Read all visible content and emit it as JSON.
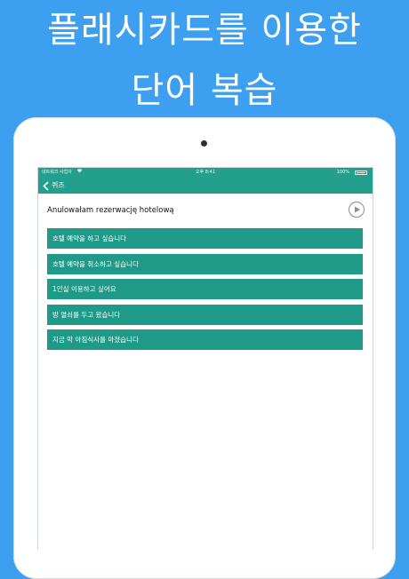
{
  "headline": {
    "line1": "플래시카드를 이용한",
    "line2": "단어 복습"
  },
  "status_bar": {
    "carrier": "네트워크 사업자",
    "time": "오후 8:41",
    "battery": "100%"
  },
  "navbar": {
    "back_label": "퀴즈"
  },
  "question": {
    "text": "Anulowałam rezerwację hotelową"
  },
  "answers": [
    "호텔 예약을 하고 싶습니다",
    "호텔 예약을 취소하고 싶습니다",
    "1인실 이용하고 싶어요",
    "방 열쇠를 두고 왔습니다",
    "지금 막 아침식사를 마쳤습니다"
  ],
  "colors": {
    "background": "#3d9ff0",
    "accent": "#23a08d",
    "answer": "#1f9a88"
  },
  "icons": {
    "back": "chevron-left-icon",
    "play": "play-circle-icon",
    "wifi": "wifi-icon",
    "battery": "battery-icon"
  }
}
